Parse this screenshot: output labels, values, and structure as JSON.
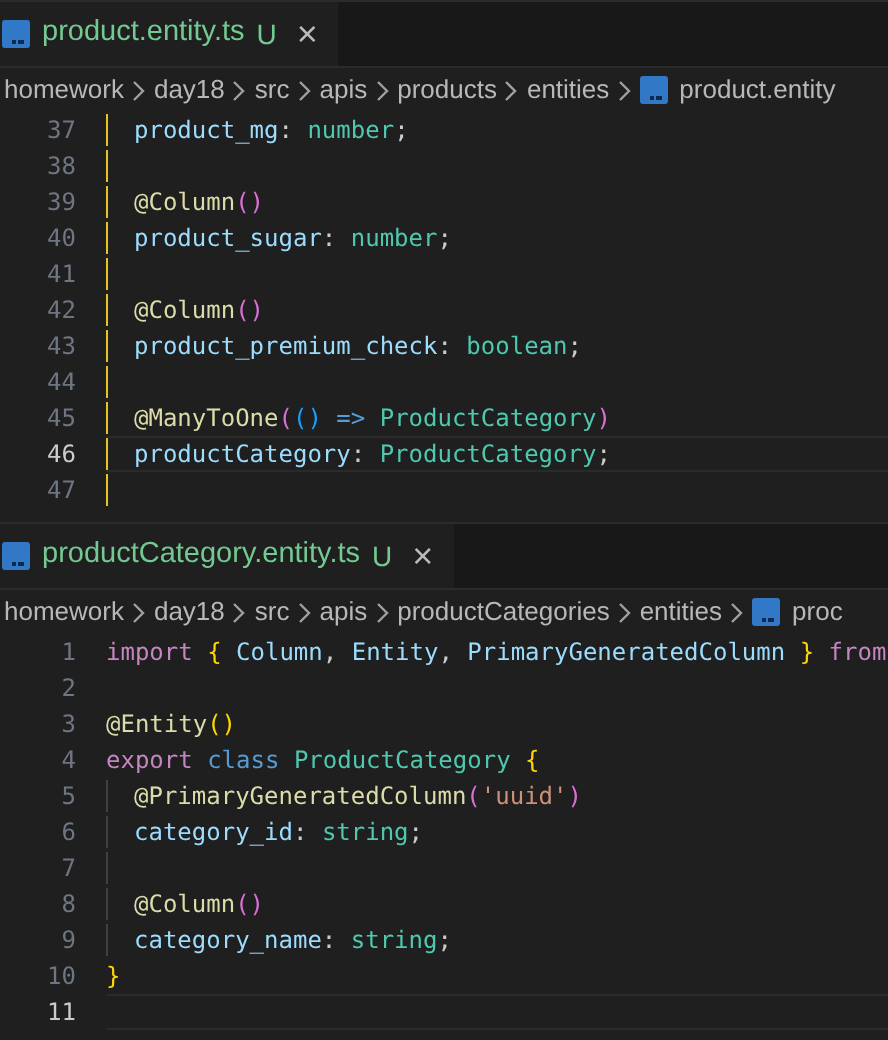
{
  "panes": [
    {
      "tab": {
        "name": "product.entity.ts",
        "status": "U",
        "close": "×",
        "selected": true
      },
      "breadcrumbs": [
        {
          "kind": "folder",
          "label": "homework"
        },
        {
          "kind": "folder",
          "label": "day18"
        },
        {
          "kind": "folder",
          "label": "src"
        },
        {
          "kind": "folder",
          "label": "apis"
        },
        {
          "kind": "folder",
          "label": "products"
        },
        {
          "kind": "folder",
          "label": "entities"
        },
        {
          "kind": "file",
          "label": "product.entity"
        }
      ],
      "guide_active": true,
      "lines": [
        {
          "number": "37",
          "indented": true,
          "current": false,
          "tokens": [
            {
              "kind": "property",
              "text": "product_mg"
            },
            {
              "kind": "punct",
              "text": ": "
            },
            {
              "kind": "type",
              "text": "number"
            },
            {
              "kind": "punct",
              "text": ";"
            }
          ]
        },
        {
          "number": "38",
          "indented": true,
          "current": false
        },
        {
          "number": "39",
          "indented": true,
          "current": false,
          "tokens": [
            {
              "kind": "decorator",
              "text": "@Column"
            },
            {
              "kind": "bracket2",
              "text": "()"
            }
          ]
        },
        {
          "number": "40",
          "indented": true,
          "current": false,
          "tokens": [
            {
              "kind": "property",
              "text": "product_sugar"
            },
            {
              "kind": "punct",
              "text": ": "
            },
            {
              "kind": "type",
              "text": "number"
            },
            {
              "kind": "punct",
              "text": ";"
            }
          ]
        },
        {
          "number": "41",
          "indented": true,
          "current": false
        },
        {
          "number": "42",
          "indented": true,
          "current": false,
          "tokens": [
            {
              "kind": "decorator",
              "text": "@Column"
            },
            {
              "kind": "bracket2",
              "text": "()"
            }
          ]
        },
        {
          "number": "43",
          "indented": true,
          "current": false,
          "tokens": [
            {
              "kind": "property",
              "text": "product_premium_check"
            },
            {
              "kind": "punct",
              "text": ": "
            },
            {
              "kind": "type",
              "text": "boolean"
            },
            {
              "kind": "punct",
              "text": ";"
            }
          ]
        },
        {
          "number": "44",
          "indented": true,
          "current": false
        },
        {
          "number": "45",
          "indented": true,
          "current": false,
          "tokens": [
            {
              "kind": "decorator",
              "text": "@ManyToOne"
            },
            {
              "kind": "bracket2",
              "text": "("
            },
            {
              "kind": "bracket3",
              "text": "()"
            },
            {
              "kind": "keyword2",
              "text": " => "
            },
            {
              "kind": "type",
              "text": "ProductCategory"
            },
            {
              "kind": "bracket2",
              "text": ")"
            }
          ]
        },
        {
          "number": "46",
          "indented": true,
          "current": true,
          "tokens": [
            {
              "kind": "property",
              "text": "productCategory"
            },
            {
              "kind": "punct",
              "text": ": "
            },
            {
              "kind": "type",
              "text": "ProductCategory"
            },
            {
              "kind": "punct",
              "text": ";"
            }
          ]
        },
        {
          "number": "47",
          "indented": true,
          "current": false
        }
      ]
    },
    {
      "tab": {
        "name": "productCategory.entity.ts",
        "status": "U",
        "close": "×",
        "selected": true
      },
      "breadcrumbs": [
        {
          "kind": "folder",
          "label": "homework"
        },
        {
          "kind": "folder",
          "label": "day18"
        },
        {
          "kind": "folder",
          "label": "src"
        },
        {
          "kind": "folder",
          "label": "apis"
        },
        {
          "kind": "folder",
          "label": "productCategories"
        },
        {
          "kind": "folder",
          "label": "entities"
        },
        {
          "kind": "file",
          "label": "proc"
        }
      ],
      "guide_active": false,
      "lines": [
        {
          "number": "1",
          "indented": false,
          "current": false,
          "tokens": [
            {
              "kind": "keyword",
              "text": "import "
            },
            {
              "kind": "bracket1",
              "text": "{"
            },
            {
              "kind": "property",
              "text": " Column"
            },
            {
              "kind": "punct",
              "text": ", "
            },
            {
              "kind": "property",
              "text": "Entity"
            },
            {
              "kind": "punct",
              "text": ", "
            },
            {
              "kind": "property",
              "text": "PrimaryGeneratedColumn "
            },
            {
              "kind": "bracket1",
              "text": "}"
            },
            {
              "kind": "keyword",
              "text": " from"
            }
          ]
        },
        {
          "number": "2",
          "indented": false,
          "current": false
        },
        {
          "number": "3",
          "indented": false,
          "current": false,
          "tokens": [
            {
              "kind": "decorator",
              "text": "@Entity"
            },
            {
              "kind": "bracket1",
              "text": "()"
            }
          ]
        },
        {
          "number": "4",
          "indented": false,
          "current": false,
          "tokens": [
            {
              "kind": "keyword",
              "text": "export "
            },
            {
              "kind": "keyword2",
              "text": "class "
            },
            {
              "kind": "type",
              "text": "ProductCategory "
            },
            {
              "kind": "bracket1",
              "text": "{"
            }
          ]
        },
        {
          "number": "5",
          "indented": true,
          "current": false,
          "tokens": [
            {
              "kind": "decorator",
              "text": "@PrimaryGeneratedColumn"
            },
            {
              "kind": "bracket2",
              "text": "("
            },
            {
              "kind": "string",
              "text": "'uuid'"
            },
            {
              "kind": "bracket2",
              "text": ")"
            }
          ]
        },
        {
          "number": "6",
          "indented": true,
          "current": false,
          "tokens": [
            {
              "kind": "property",
              "text": "category_id"
            },
            {
              "kind": "punct",
              "text": ": "
            },
            {
              "kind": "type",
              "text": "string"
            },
            {
              "kind": "punct",
              "text": ";"
            }
          ]
        },
        {
          "number": "7",
          "indented": true,
          "current": false
        },
        {
          "number": "8",
          "indented": true,
          "current": false,
          "tokens": [
            {
              "kind": "decorator",
              "text": "@Column"
            },
            {
              "kind": "bracket2",
              "text": "()"
            }
          ]
        },
        {
          "number": "9",
          "indented": true,
          "current": false,
          "tokens": [
            {
              "kind": "property",
              "text": "category_name"
            },
            {
              "kind": "punct",
              "text": ": "
            },
            {
              "kind": "type",
              "text": "string"
            },
            {
              "kind": "punct",
              "text": ";"
            }
          ]
        },
        {
          "number": "10",
          "indented": false,
          "current": false,
          "tokens": [
            {
              "kind": "bracket1",
              "text": "}"
            }
          ]
        },
        {
          "number": "11",
          "indented": false,
          "current": true
        }
      ]
    }
  ]
}
